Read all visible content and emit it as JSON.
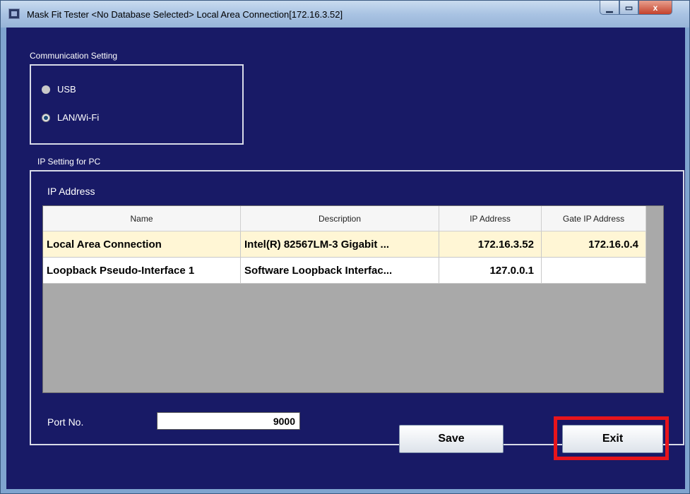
{
  "window": {
    "title": "Mask Fit Tester <No Database Selected> Local Area Connection[172.16.3.52]",
    "controls": {
      "minimize": "▁",
      "maximize": "▭",
      "close": "x"
    }
  },
  "communication": {
    "label": "Communication Setting",
    "options": [
      {
        "label": "USB",
        "checked": false
      },
      {
        "label": "LAN/Wi-Fi",
        "checked": true
      }
    ]
  },
  "ip_setting": {
    "label": "IP Setting for PC",
    "sub_label": "IP Address",
    "table": {
      "headers": [
        "Name",
        "Description",
        "IP Address",
        "Gate IP Address"
      ],
      "rows": [
        [
          "Local Area Connection",
          "Intel(R) 82567LM-3 Gigabit ...",
          "172.16.3.52",
          "172.16.0.4"
        ],
        [
          "Loopback Pseudo-Interface 1",
          "Software Loopback Interfac...",
          "127.0.0.1",
          ""
        ]
      ],
      "selected_row": 0
    },
    "port_label": "Port No.",
    "port_value": "9000"
  },
  "buttons": {
    "save": "Save",
    "exit": "Exit"
  },
  "colors": {
    "background": "#181a66",
    "selected_row": "#fff6d5",
    "highlight": "#e8141b"
  }
}
